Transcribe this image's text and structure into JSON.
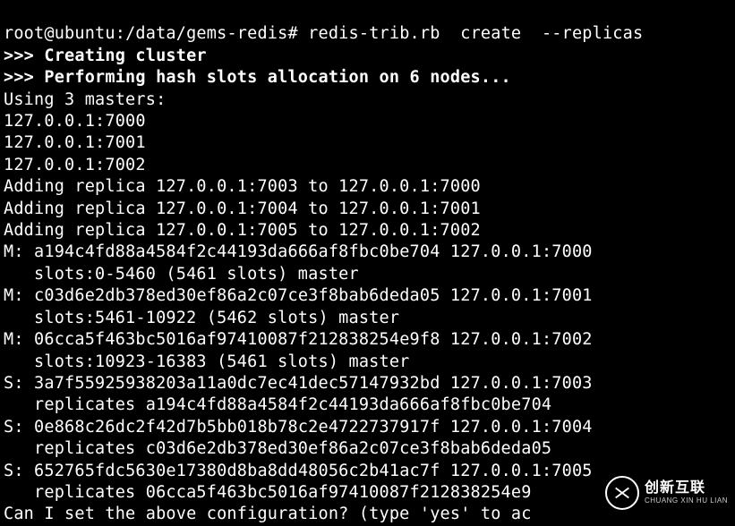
{
  "prompt": {
    "user_host": "root@ubuntu",
    "path": "/data/gems-redis",
    "sep": "#",
    "command": "redis-trib.rb  create  --replicas"
  },
  "msg": {
    "creating": ">>> Creating cluster",
    "performing": ">>> Performing hash slots allocation on 6 nodes..."
  },
  "using_masters": "Using 3 masters:",
  "masters_list": [
    "127.0.0.1:7000",
    "127.0.0.1:7001",
    "127.0.0.1:7002"
  ],
  "adding_replicas": [
    "Adding replica 127.0.0.1:7003 to 127.0.0.1:7000",
    "Adding replica 127.0.0.1:7004 to 127.0.0.1:7001",
    "Adding replica 127.0.0.1:7005 to 127.0.0.1:7002"
  ],
  "nodes": [
    {
      "tag": "M:",
      "id": "a194c4fd88a4584f2c44193da666af8fbc0be704",
      "addr": "127.0.0.1:7000",
      "detail_indent": "   slots:0-5460 (5461 slots) master"
    },
    {
      "tag": "M:",
      "id": "c03d6e2db378ed30ef86a2c07ce3f8bab6deda05",
      "addr": "127.0.0.1:7001",
      "detail_indent": "   slots:5461-10922 (5462 slots) master"
    },
    {
      "tag": "M:",
      "id": "06cca5f463bc5016af97410087f212838254e9f8",
      "addr": "127.0.0.1:7002",
      "detail_indent": "   slots:10923-16383 (5461 slots) master"
    },
    {
      "tag": "S:",
      "id": "3a7f55925938203a11a0dc7ec41dec57147932bd",
      "addr": "127.0.0.1:7003",
      "detail_indent": "   replicates a194c4fd88a4584f2c44193da666af8fbc0be704"
    },
    {
      "tag": "S:",
      "id": "0e868c26dc2f42d7b5bb018b78c2e4722737917f",
      "addr": "127.0.0.1:7004",
      "detail_indent": "   replicates c03d6e2db378ed30ef86a2c07ce3f8bab6deda05"
    },
    {
      "tag": "S:",
      "id": "652765fdc5630e17380d8ba8dd48056c2b41ac7f",
      "addr": "127.0.0.1:7005",
      "detail_indent": "   replicates 06cca5f463bc5016af97410087f212838254e9"
    }
  ],
  "confirm": "Can I set the above configuration? (type 'yes' to ac",
  "watermark": {
    "big": "创新互联",
    "small": "CHUANG XIN HU LIAN"
  }
}
